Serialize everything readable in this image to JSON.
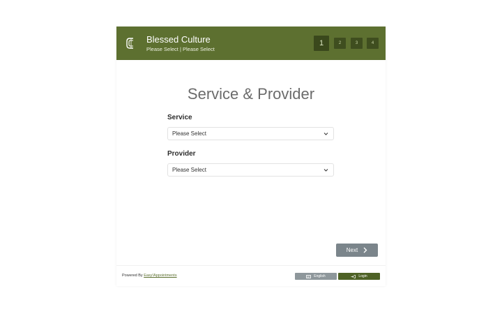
{
  "header": {
    "company_name": "Blessed Culture",
    "selection_text": "Please Select | Please Select",
    "steps": [
      "1",
      "2",
      "3",
      "4"
    ],
    "active_step": "1",
    "colors": {
      "header_bg": "#5d7030",
      "step_bg": "#3f4e1f"
    },
    "logo_icon": "c-logo-icon"
  },
  "main": {
    "title": "Service & Provider",
    "service": {
      "label": "Service",
      "value": "Please Select"
    },
    "provider": {
      "label": "Provider",
      "value": "Please Select"
    },
    "next_label": "Next"
  },
  "footer": {
    "powered_prefix": "Powered By ",
    "powered_link": "Easy!Appointments",
    "language_label": "English",
    "login_label": "Login"
  }
}
